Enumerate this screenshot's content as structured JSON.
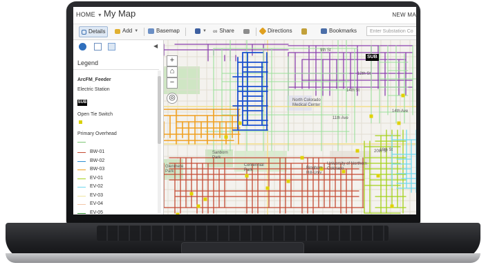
{
  "app": {
    "nav_home": "HOME",
    "map_title": "My Map",
    "new_map": "NEW MA"
  },
  "toolbar": {
    "details": "Details",
    "add": "Add",
    "basemap": "Basemap",
    "share": "Share",
    "directions": "Directions",
    "bookmarks": "Bookmarks",
    "search_placeholder": "Enter Substation Co"
  },
  "legend": {
    "title": "Legend",
    "layer": "ArcFM_Feeder",
    "electric_station": "Electric Station",
    "sub_label": "SUB",
    "open_tie_switch": "Open Tie Switch",
    "primary_overhead": "Primary Overhead",
    "feeders": [
      {
        "name": "BW-01",
        "color": "#c44a32"
      },
      {
        "name": "BW-02",
        "color": "#2f8fd1"
      },
      {
        "name": "BW-03",
        "color": "#f0a020"
      },
      {
        "name": "EV-01",
        "color": "#a4d11a"
      },
      {
        "name": "EV-02",
        "color": "#6fd8ee"
      },
      {
        "name": "EV-03",
        "color": "#f0e4a0"
      },
      {
        "name": "EV-04",
        "color": "#f3c6a8"
      },
      {
        "name": "EV-05",
        "color": "#2e8a2e"
      }
    ]
  },
  "map": {
    "zoom_in": "+",
    "zoom_out": "−",
    "sub_label": "SUB",
    "labels": [
      "9th St",
      "12th St",
      "14th St",
      "11th Ave",
      "University of Northern Colorado",
      "Sanborn Park",
      "Centennial Park",
      "North Colorado Medical Center",
      "Bingham Hill-Univ",
      "16th St",
      "20th St",
      "14th Ave",
      "Glenmere Park"
    ]
  },
  "colors": {
    "purple": "#8a3fae",
    "deep_blue": "#1a4fcf",
    "feeder_green": "#9be09b",
    "map_bg": "#f4f2ee"
  }
}
